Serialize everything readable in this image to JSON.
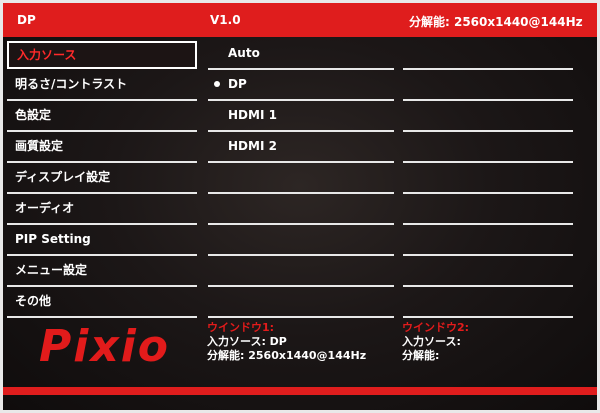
{
  "header": {
    "source": "DP",
    "version": "V1.0",
    "resolution": "分解能: 2560x1440@144Hz"
  },
  "menu": {
    "items": [
      {
        "label": "入力ソース"
      },
      {
        "label": "明るさ/コントラスト"
      },
      {
        "label": "色設定"
      },
      {
        "label": "画質設定"
      },
      {
        "label": "ディスプレイ設定"
      },
      {
        "label": "オーディオ"
      },
      {
        "label": "PIP Setting"
      },
      {
        "label": "メニュー設定"
      },
      {
        "label": "その他"
      }
    ]
  },
  "options": {
    "items": [
      {
        "label": "Auto"
      },
      {
        "label": "DP"
      },
      {
        "label": "HDMI 1"
      },
      {
        "label": "HDMI 2"
      }
    ]
  },
  "logo": {
    "text": "Pixio"
  },
  "window1": {
    "title": "ウインドウ1:",
    "source": "入力ソース:  DP",
    "resolution": "分解能:  2560x1440@144Hz"
  },
  "window2": {
    "title": "ウインドウ2:",
    "source": "入力ソース:",
    "resolution": "分解能:"
  },
  "colors": {
    "accent": "#df1d1d",
    "background": "#1c1717",
    "text": "#ffffff"
  }
}
